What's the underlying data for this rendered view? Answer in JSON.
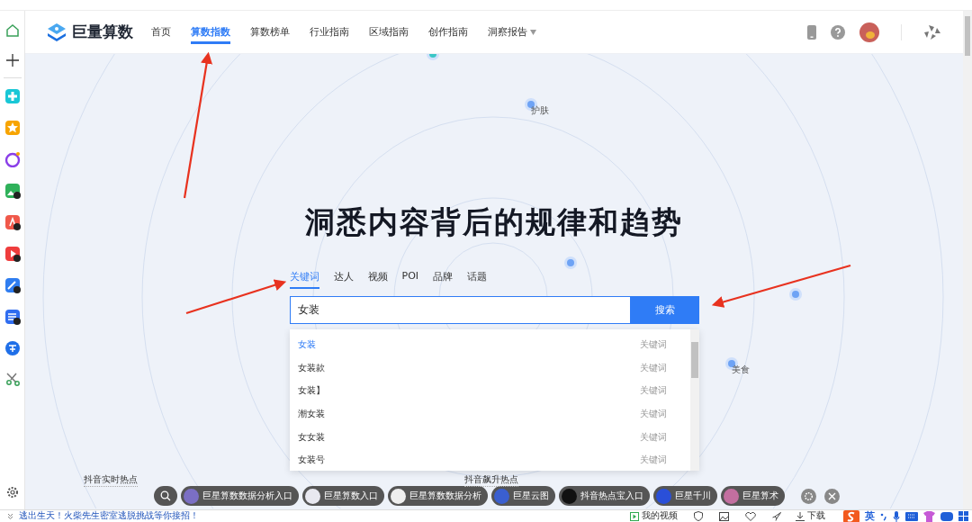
{
  "nav": {
    "logo": "巨量算数",
    "items": [
      {
        "label": "首页",
        "selected": false,
        "kind": "link"
      },
      {
        "label": "算数指数",
        "selected": true,
        "kind": "link"
      },
      {
        "label": "算数榜单",
        "selected": false,
        "kind": "link"
      },
      {
        "label": "行业指南",
        "selected": false,
        "kind": "link"
      },
      {
        "label": "区域指南",
        "selected": false,
        "kind": "link"
      },
      {
        "label": "创作指南",
        "selected": false,
        "kind": "link"
      },
      {
        "label": "洞察报告",
        "selected": false,
        "kind": "dropdown"
      }
    ]
  },
  "topics": [
    {
      "label": "护肤"
    },
    {
      "label": "美食"
    }
  ],
  "hero": {
    "title": "洞悉内容背后的规律和趋势"
  },
  "search": {
    "tabs": [
      {
        "label": "关键词",
        "selected": true
      },
      {
        "label": "达人",
        "selected": false
      },
      {
        "label": "视频",
        "selected": false
      },
      {
        "label": "POI",
        "selected": false
      },
      {
        "label": "品牌",
        "selected": false
      },
      {
        "label": "话题",
        "selected": false
      }
    ],
    "value": "女装",
    "button": "搜索",
    "suggestions": [
      {
        "text": "女装",
        "type": "关键词",
        "selected": true
      },
      {
        "text": "女装款",
        "type": "关键词",
        "selected": false
      },
      {
        "text": "女装】",
        "type": "关键词",
        "selected": false
      },
      {
        "text": "潮女装",
        "type": "关键词",
        "selected": false
      },
      {
        "text": "女女装",
        "type": "关键词",
        "selected": false
      },
      {
        "text": "女装号",
        "type": "关键词",
        "selected": false
      }
    ]
  },
  "hot": {
    "labels": [
      "抖音实时热点",
      "抖音飙升热点"
    ],
    "shortcuts": [
      {
        "label": "巨星算数数据分析入口",
        "color": "#7b6fc4"
      },
      {
        "label": "巨星算数入口",
        "color": "#e8e8f0"
      },
      {
        "label": "巨星算数数据分析",
        "color": "#eeeeee"
      },
      {
        "label": "巨星云图",
        "color": "#3a5fd0"
      },
      {
        "label": "抖音热点宝入口",
        "color": "#111111"
      },
      {
        "label": "巨星千川",
        "color": "#2a4fd8"
      },
      {
        "label": "巨星算术",
        "color": "#c36fa0"
      }
    ]
  },
  "status_bar": {
    "news": "逃出生天！火柴先生密室逃脱挑战等你接招！",
    "videos": "我的视频",
    "download": "下载",
    "ime": "英"
  }
}
